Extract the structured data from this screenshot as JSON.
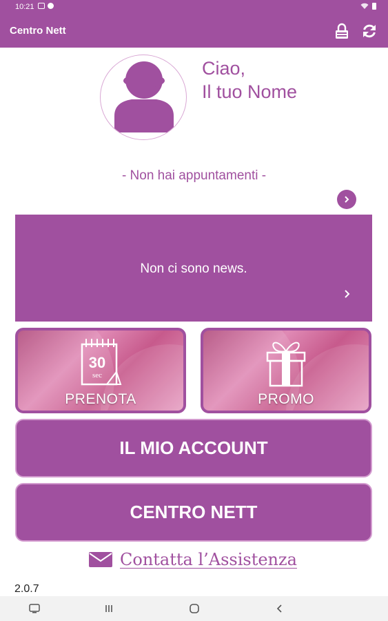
{
  "status_bar": {
    "time": "10:21"
  },
  "app_bar": {
    "title": "Centro Nett"
  },
  "profile": {
    "greeting_line1": "Ciao,",
    "greeting_line2": "Il tuo Nome"
  },
  "appointments": {
    "text": "- Non hai appuntamenti -"
  },
  "news": {
    "text": "Non ci sono news."
  },
  "tiles": {
    "prenota": {
      "label": "PRENOTA",
      "icon_text": "30",
      "icon_subtext": "sec"
    },
    "promo": {
      "label": "PROMO"
    }
  },
  "buttons": {
    "account": "IL MIO ACCOUNT",
    "centro": "CENTRO NETT"
  },
  "contact": {
    "label": "Contatta l’Assistenza"
  },
  "version": "2.0.7",
  "colors": {
    "brand": "#a0509f",
    "light_brand": "#d39bcf",
    "nav_bg": "#f2f2f2"
  },
  "icons": [
    "lock-icon",
    "refresh-icon",
    "chevron-right-icon",
    "calendar-icon",
    "gift-icon",
    "mail-icon",
    "avatar-silhouette"
  ]
}
